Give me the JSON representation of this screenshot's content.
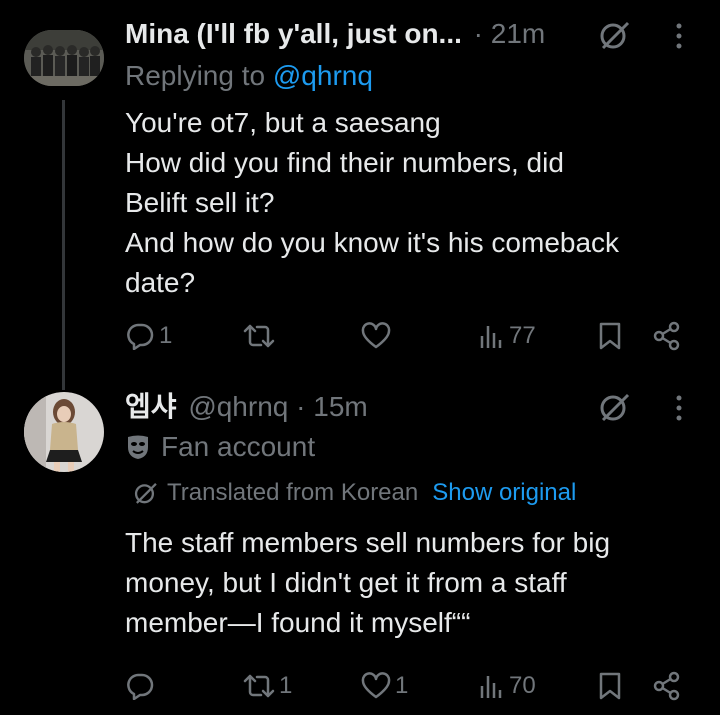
{
  "tweet1": {
    "display_name": "Mina (I'll fb y'all, just on...",
    "time": "· 21m",
    "replying_prefix": "Replying to ",
    "replying_handle": "@qhrnq",
    "text_lines": [
      "You're ot7, but a saesang",
      "How did you find their numbers, did",
      "Belift sell it?",
      "And how do you know it's his comeback",
      "date?"
    ],
    "replies": "1",
    "retweets": "",
    "likes": "",
    "views": "77"
  },
  "tweet2": {
    "display_name": "엡샤",
    "handle": "@qhrnq",
    "time": "· 15m",
    "label": "Fan account",
    "translated": "Translated from Korean",
    "show_original": "Show original",
    "text_lines": [
      "The staff members sell numbers for big",
      "money, but I didn't get it from a staff",
      "member—I found it myself““"
    ],
    "replies": "",
    "retweets": "1",
    "likes": "1",
    "views": "70"
  },
  "colors": {
    "background": "#000000",
    "text": "#e7e9ea",
    "muted": "#71767b",
    "link": "#1d9bf0"
  }
}
